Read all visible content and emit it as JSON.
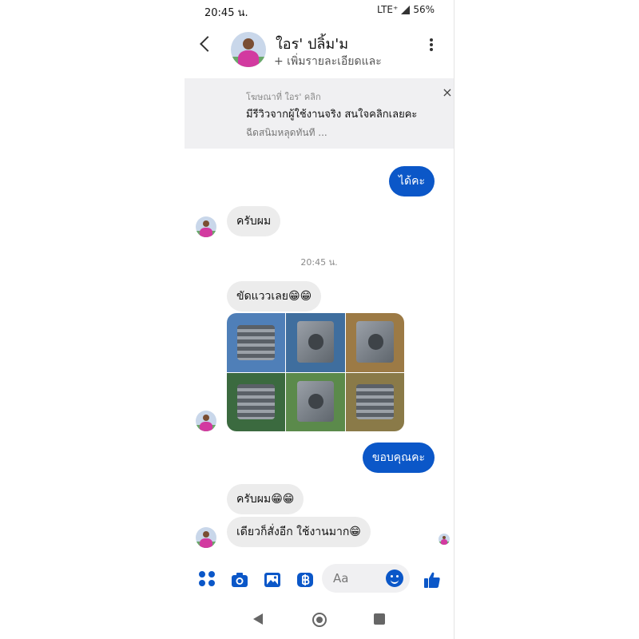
{
  "status_bar": {
    "time": "20:45 น.",
    "network": "LTE⁺",
    "battery": "56%"
  },
  "header": {
    "name": "ใอร' ปลิ้ม'ม",
    "subtitle": "+ เพิ่มรายละเอียดและ"
  },
  "ad": {
    "label": "โฆษณาที่ ใอร' คลิก",
    "title": "มีรีวิวจากผู้ใช้งานจริง สนใจคลิกเลยคะ",
    "description": "ฉีดสนิมหลุดทันที ...",
    "close": "×"
  },
  "messages": {
    "m1": "ได้คะ",
    "m2": "ครับผม",
    "timestamp": "20:45 น.",
    "m3": "ขัดแววเลย😁😁",
    "m4": "ขอบคุณคะ",
    "m5": "ครับผม😁😁",
    "m6": "เดียวก็สั่งอีก ใช้งานมาก😁"
  },
  "photos": [
    {
      "name": "cylinder-photo-1",
      "bg": "#4f7fb8"
    },
    {
      "name": "cylinder-photo-2",
      "bg": "#3f6e9e"
    },
    {
      "name": "cylinder-photo-3",
      "bg": "#9c7a45"
    },
    {
      "name": "cylinder-photo-4",
      "bg": "#3b6a3f"
    },
    {
      "name": "cylinder-photo-5",
      "bg": "#5b8a4b"
    },
    {
      "name": "cylinder-photo-6",
      "bg": "#8a7a48"
    }
  ],
  "composer": {
    "placeholder": "Aa",
    "icons": [
      "apps-icon",
      "camera-icon",
      "gallery-icon",
      "baht-payment-icon",
      "emoji-icon",
      "thumbs-up-icon"
    ]
  },
  "colors": {
    "accent": "#0b57c8",
    "incoming_bubble": "#ececec",
    "ad_background": "#f0f0f2"
  }
}
